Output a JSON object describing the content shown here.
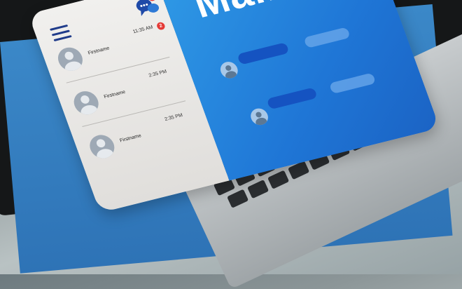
{
  "app": {
    "title": "Mail"
  },
  "sidebar": {
    "menu_icon": "hamburger-menu-icon",
    "chat_icon": "chat-bubbles-icon",
    "chat_badge": "2",
    "contacts": [
      {
        "name": "Firstname",
        "time": "11:35 AM",
        "badge": "2"
      },
      {
        "name": "Firstname",
        "time": "2:35 PM"
      },
      {
        "name": "Firstname",
        "time": "2:35 PM"
      }
    ]
  },
  "colors": {
    "accent_blue": "#1f76d6",
    "badge_red": "#e53935",
    "menu_navy": "#1f3b8a",
    "sidebar_bg": "#f1f0ee"
  }
}
